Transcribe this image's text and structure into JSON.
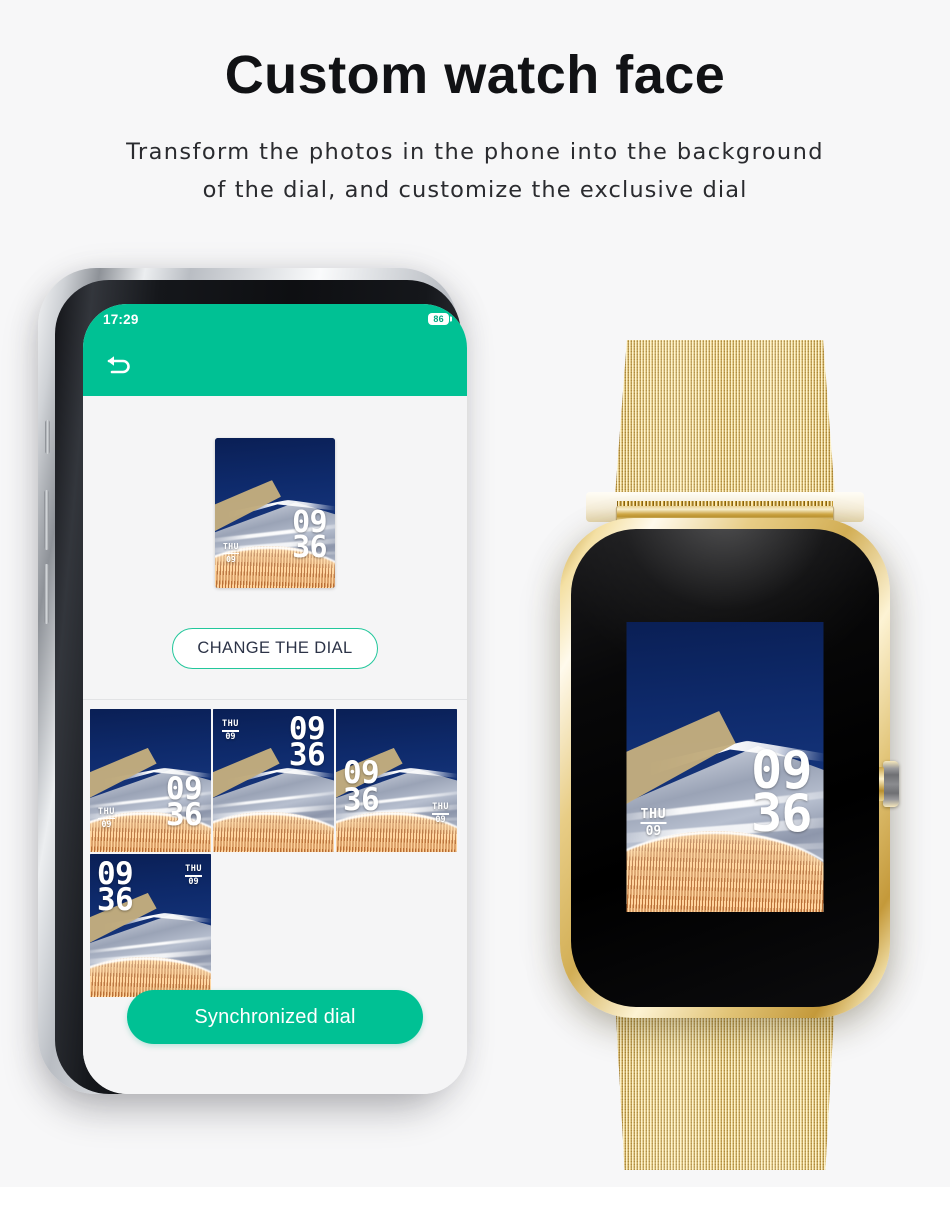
{
  "page": {
    "headline": "Custom watch face",
    "subtitle_line1": "Transform the photos in the phone into the background",
    "subtitle_line2": "of the dial, and customize the exclusive dial",
    "background_color": "#f7f7f8",
    "accent_color": "#00c194"
  },
  "phone": {
    "status_bar": {
      "time": "17:29",
      "battery_level": "86"
    },
    "nav": {
      "back_icon": "back-arrow-icon"
    },
    "preview": {
      "dial_time_hour": "09",
      "dial_time_minute": "36",
      "dial_day_of_week": "THU",
      "dial_day_number": "09"
    },
    "change_dial_button": {
      "label": "CHANGE THE DIAL",
      "border_color": "#22c79b",
      "text_color": "#2c3347"
    },
    "sync_button": {
      "label": "Synchronized dial",
      "background_color": "#00c194",
      "text_color": "#ffffff"
    },
    "thumbnails": [
      {
        "name": "dial-style-bottom-right",
        "time_hour": "09",
        "time_minute": "36",
        "day_of_week": "THU",
        "day_number": "09",
        "time_position": "bottom-right",
        "date_position": "bottom-left"
      },
      {
        "name": "dial-style-top",
        "time_hour": "09",
        "time_minute": "36",
        "day_of_week": "THU",
        "day_number": "09",
        "time_position": "top-right",
        "date_position": "top-left"
      },
      {
        "name": "dial-style-middle-left",
        "time_hour": "09",
        "time_minute": "36",
        "day_of_week": "THU",
        "day_number": "09",
        "time_position": "middle-left",
        "date_position": "middle-right"
      },
      {
        "name": "dial-style-top-left",
        "time_hour": "09",
        "time_minute": "36",
        "day_of_week": "THU",
        "day_number": "09",
        "time_position": "top-left",
        "date_position": "top-right"
      }
    ]
  },
  "watch": {
    "case_color": "gold",
    "band_type": "milanese-mesh-gold",
    "face": {
      "time_hour": "09",
      "time_minute": "36",
      "day_of_week": "THU",
      "day_number": "09"
    }
  }
}
